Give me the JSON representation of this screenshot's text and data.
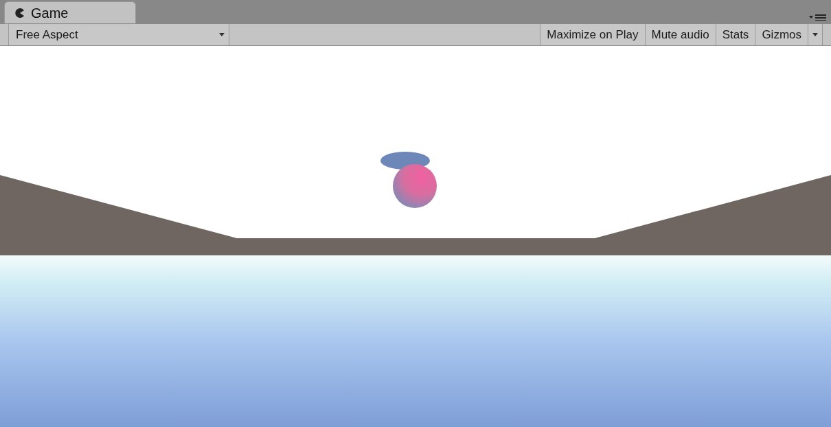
{
  "tab": {
    "title": "Game"
  },
  "toolbar": {
    "aspect_dropdown": "Free Aspect",
    "buttons": [
      "Maximize on Play",
      "Mute audio",
      "Stats",
      "Gizmos"
    ]
  }
}
